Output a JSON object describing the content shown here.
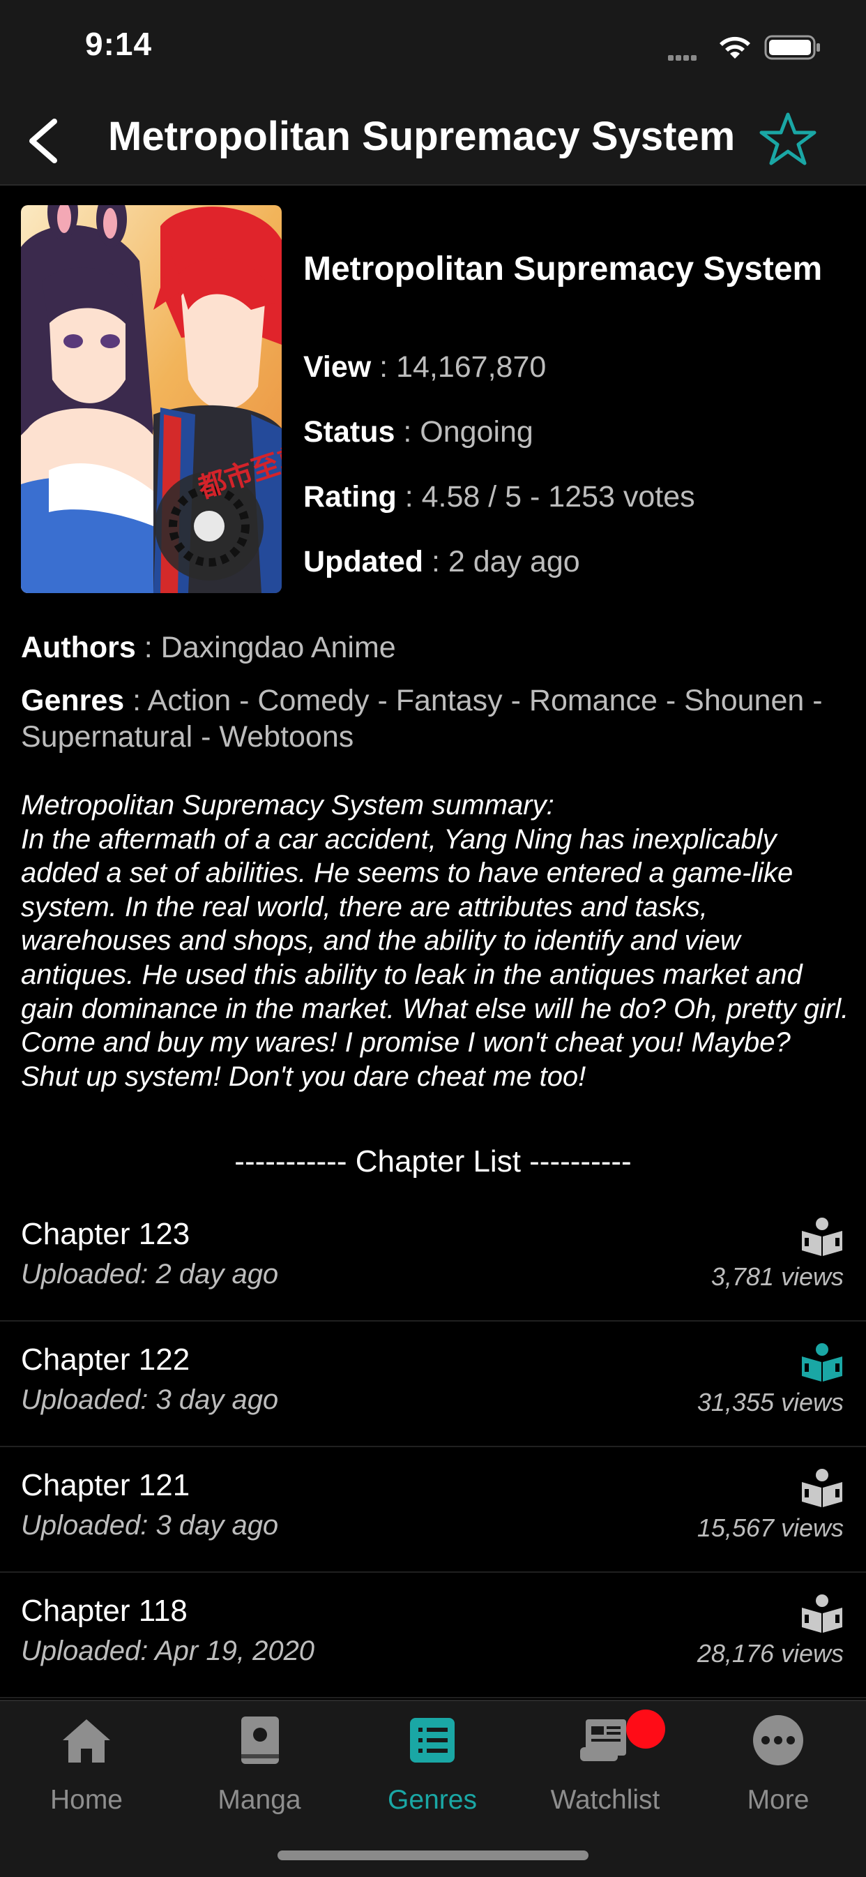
{
  "status_bar": {
    "time": "9:14"
  },
  "nav": {
    "title": "Metropolitan Supremacy System",
    "accent_color": "#1aa7a5"
  },
  "manga": {
    "title": "Metropolitan Supremacy System",
    "view_label": "View",
    "view_value": "14,167,870",
    "status_label": "Status",
    "status_value": "Ongoing",
    "rating_label": "Rating",
    "rating_value": "4.58 / 5 - 1253 votes",
    "updated_label": "Updated",
    "updated_value": "2 day ago",
    "authors_label": "Authors",
    "authors_value": "Daxingdao Anime",
    "genres_label": "Genres",
    "genres_value": "Action - Comedy - Fantasy - Romance - Shounen - Supernatural - Webtoons",
    "cover_text": "都市至尊系统"
  },
  "summary": {
    "heading": "Metropolitan Supremacy System summary:",
    "text": "In the aftermath of a car accident, Yang Ning has inexplicably added a set of abilities. He seems to have entered a game-like system. In the real world, there are attributes and tasks, warehouses and shops, and the ability to identify and view antiques. He used this ability to leak in the antiques market and gain dominance in the market. What else will he do? Oh, pretty girl. Come and buy my wares! I promise I won't cheat you! Maybe? Shut up system! Don't you dare cheat me too!"
  },
  "chapter_list": {
    "header": "----------- Chapter List ----------",
    "chapters": [
      {
        "title": "Chapter 123",
        "uploaded": "Uploaded: 2 day ago",
        "views": "3,781 views",
        "icon": "book-reader-icon",
        "highlighted": false
      },
      {
        "title": "Chapter 122",
        "uploaded": "Uploaded: 3 day ago",
        "views": "31,355 views",
        "icon": "book-reader-icon",
        "highlighted": true
      },
      {
        "title": "Chapter 121",
        "uploaded": "Uploaded: 3 day ago",
        "views": "15,567 views",
        "icon": "book-reader-icon",
        "highlighted": false
      },
      {
        "title": "Chapter 118",
        "uploaded": "Uploaded: Apr 19, 2020",
        "views": "28,176 views",
        "icon": "book-reader-icon",
        "highlighted": false
      }
    ]
  },
  "tabs": [
    {
      "label": "Home",
      "icon": "home-icon",
      "active": false
    },
    {
      "label": "Manga",
      "icon": "manga-book-icon",
      "active": false
    },
    {
      "label": "Genres",
      "icon": "genres-list-icon",
      "active": true
    },
    {
      "label": "Watchlist",
      "icon": "watchlist-icon",
      "active": false,
      "badge": true
    },
    {
      "label": "More",
      "icon": "more-icon",
      "active": false
    }
  ]
}
